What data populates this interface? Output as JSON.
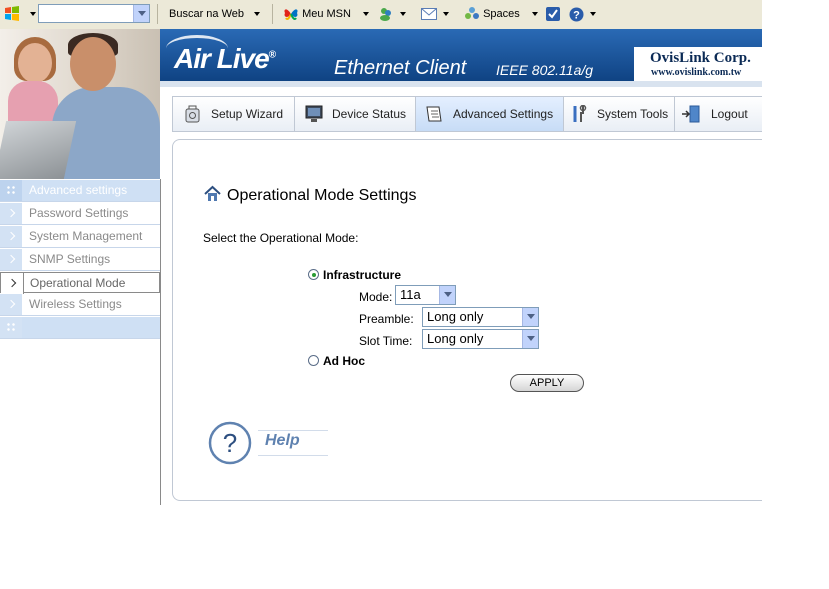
{
  "toolbar": {
    "search_label": "Buscar na Web",
    "msn_label": "Meu MSN",
    "spaces_label": "Spaces",
    "icons": [
      "windows-flag-icon",
      "msn-butterfly-icon",
      "messenger-icon",
      "mail-icon",
      "spaces-icon",
      "checkbox-icon",
      "help-icon"
    ]
  },
  "banner": {
    "logo": "Air Live",
    "logo_mark": "®",
    "product": "Ethernet Client",
    "product_sub": "IEEE 802.11a/g",
    "company": "OvisLink Corp.",
    "company_url": "www.ovislink.com.tw"
  },
  "nav": {
    "tabs": [
      {
        "label": "Setup Wizard",
        "icon": "setup-wizard-icon"
      },
      {
        "label": "Device Status",
        "icon": "monitor-icon"
      },
      {
        "label": "Advanced Settings",
        "icon": "notepad-icon",
        "active": true
      },
      {
        "label": "System Tools",
        "icon": "tools-icon"
      },
      {
        "label": "Logout",
        "icon": "door-exit-icon"
      }
    ]
  },
  "sidebar": {
    "header": "Advanced settings",
    "items": [
      {
        "label": "Password Settings"
      },
      {
        "label": "System Management"
      },
      {
        "label": "SNMP Settings"
      },
      {
        "label": "Operational Mode",
        "active": true
      },
      {
        "label": "Wireless Settings"
      }
    ]
  },
  "main": {
    "title": "Operational Mode Settings",
    "instruction": "Select the Operational Mode:",
    "infrastructure_label": "Infrastructure",
    "infrastructure_checked": true,
    "mode_label": "Mode:",
    "mode_value": "11a",
    "preamble_label": "Preamble:",
    "preamble_value": "Long only",
    "slot_time_label": "Slot Time:",
    "slot_time_value": "Long only",
    "adhoc_label": "Ad Hoc",
    "adhoc_checked": false,
    "apply_label": "APPLY",
    "help_label": "Help"
  },
  "colors": {
    "banner_blue": "#0c3e7d",
    "sidebar_blue": "#cfe0f4",
    "radio_green": "#2a9c34",
    "help_blue": "#5f82b0"
  }
}
